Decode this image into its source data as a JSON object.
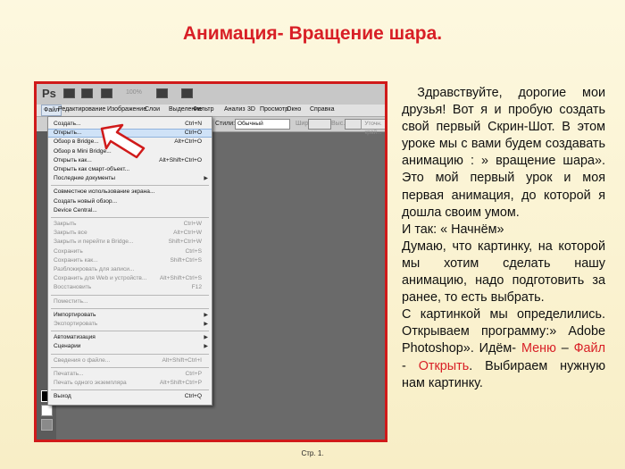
{
  "title": "Анимация- Вращение шара.",
  "footer": "Стр. 1.",
  "screenshot": {
    "logo": "Ps",
    "zoom": "100%",
    "menubar": [
      "Файл",
      "Редактирование",
      "Изображение",
      "Слои",
      "Выделение",
      "Фильтр",
      "Анализ",
      "3D",
      "Просмотр",
      "Окно",
      "Справка"
    ],
    "options": {
      "styles_label": "Стили:",
      "styles_value": "Обычный",
      "width_label": "Шир.:",
      "height_label": "Выс.:",
      "refine_button": "Уточн. край..."
    },
    "menu_items": [
      {
        "label": "Создать...",
        "shortcut": "Ctrl+N",
        "disabled": false
      },
      {
        "label": "Открыть...",
        "shortcut": "Ctrl+O",
        "disabled": false,
        "highlight": true
      },
      {
        "label": "Обзор в Bridge...",
        "shortcut": "Alt+Ctrl+O",
        "disabled": false
      },
      {
        "label": "Обзор в Mini Bridge...",
        "shortcut": "",
        "disabled": false
      },
      {
        "label": "Открыть как...",
        "shortcut": "Alt+Shift+Ctrl+O",
        "disabled": false
      },
      {
        "label": "Открыть как смарт-объект...",
        "shortcut": "",
        "disabled": false
      },
      {
        "label": "Последние документы",
        "shortcut": "",
        "disabled": false,
        "submenu": true
      },
      {
        "sep": true
      },
      {
        "label": "Совместное использование экрана...",
        "shortcut": "",
        "disabled": false
      },
      {
        "label": "Создать новый обзор...",
        "shortcut": "",
        "disabled": false
      },
      {
        "label": "Device Central...",
        "shortcut": "",
        "disabled": false
      },
      {
        "sep": true
      },
      {
        "label": "Закрыть",
        "shortcut": "Ctrl+W",
        "disabled": true
      },
      {
        "label": "Закрыть все",
        "shortcut": "Alt+Ctrl+W",
        "disabled": true
      },
      {
        "label": "Закрыть и перейти в Bridge...",
        "shortcut": "Shift+Ctrl+W",
        "disabled": true
      },
      {
        "label": "Сохранить",
        "shortcut": "Ctrl+S",
        "disabled": true
      },
      {
        "label": "Сохранить как...",
        "shortcut": "Shift+Ctrl+S",
        "disabled": true
      },
      {
        "label": "Разблокировать для записи...",
        "shortcut": "",
        "disabled": true
      },
      {
        "label": "Сохранить для Web и устройств...",
        "shortcut": "Alt+Shift+Ctrl+S",
        "disabled": true
      },
      {
        "label": "Восстановить",
        "shortcut": "F12",
        "disabled": true
      },
      {
        "sep": true
      },
      {
        "label": "Поместить...",
        "shortcut": "",
        "disabled": true
      },
      {
        "sep": true
      },
      {
        "label": "Импортировать",
        "shortcut": "",
        "disabled": false,
        "submenu": true
      },
      {
        "label": "Экспортировать",
        "shortcut": "",
        "disabled": true,
        "submenu": true
      },
      {
        "sep": true
      },
      {
        "label": "Автоматизация",
        "shortcut": "",
        "disabled": false,
        "submenu": true
      },
      {
        "label": "Сценарии",
        "shortcut": "",
        "disabled": false,
        "submenu": true
      },
      {
        "sep": true
      },
      {
        "label": "Сведения о файле...",
        "shortcut": "Alt+Shift+Ctrl+I",
        "disabled": true
      },
      {
        "sep": true
      },
      {
        "label": "Печатать...",
        "shortcut": "Ctrl+P",
        "disabled": true
      },
      {
        "label": "Печать одного экземпляра",
        "shortcut": "Alt+Shift+Ctrl+P",
        "disabled": true
      },
      {
        "sep": true
      },
      {
        "label": "Выход",
        "shortcut": "Ctrl+Q",
        "disabled": false
      }
    ]
  },
  "body": {
    "p1": "Здравствуйте, дорогие мои друзья! Вот я и пробую создать свой первый Скрин-Шот. В этом уроке мы с вами будем создавать анимацию : » вращение шара». Это мой первый урок и моя первая анимация, до которой я дошла своим умом.",
    "p2": "И так: « Начнём»",
    "p3": "Думаю, что картинку, на которой мы хотим сделать нашу анимацию, надо подготовить за ранее, то есть выбрать.",
    "p4_start": "С картинкой мы определились. Открываем программу:» Adobe Photoshop». Идём- ",
    "menu_word": "Меню",
    "dash1": " – ",
    "file_word": "Файл",
    "dash2": " - ",
    "open_word": "Открыть",
    "p4_end": ". Выбираем нужную нам картинку."
  }
}
